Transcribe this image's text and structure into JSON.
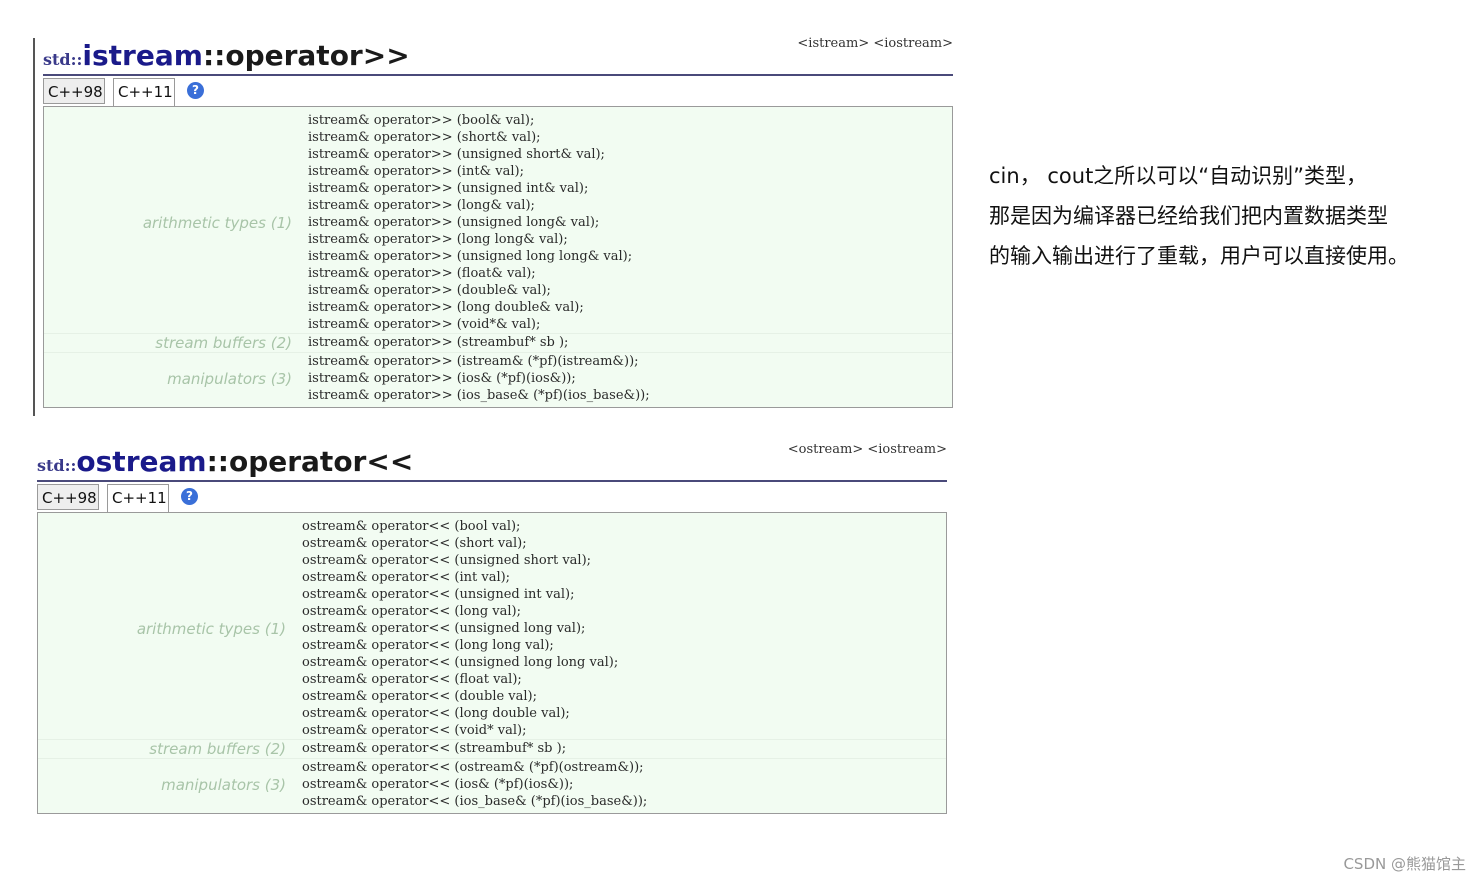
{
  "istream": {
    "title_ns": "std::",
    "title_class": "istream",
    "title_op": "::operator>>",
    "headers": "<istream> <iostream>",
    "tabs": [
      "C++98",
      "C++11"
    ],
    "help": "?",
    "groups": [
      {
        "label": "arithmetic types (1)",
        "lines": [
          "istream& operator>> (bool& val);",
          "istream& operator>> (short& val);",
          "istream& operator>> (unsigned short& val);",
          "istream& operator>> (int& val);",
          "istream& operator>> (unsigned int& val);",
          "istream& operator>> (long& val);",
          "istream& operator>> (unsigned long& val);",
          "istream& operator>> (long long& val);",
          "istream& operator>> (unsigned long long& val);",
          "istream& operator>> (float& val);",
          "istream& operator>> (double& val);",
          "istream& operator>> (long double& val);",
          "istream& operator>> (void*& val);"
        ]
      },
      {
        "label": "stream buffers (2)",
        "lines": [
          "istream& operator>> (streambuf* sb );"
        ]
      },
      {
        "label": "manipulators (3)",
        "lines": [
          "istream& operator>> (istream& (*pf)(istream&));",
          "istream& operator>> (ios& (*pf)(ios&));",
          "istream& operator>> (ios_base& (*pf)(ios_base&));"
        ]
      }
    ]
  },
  "ostream": {
    "title_ns": "std::",
    "title_class": "ostream",
    "title_op": "::operator<<",
    "headers": "<ostream> <iostream>",
    "tabs": [
      "C++98",
      "C++11"
    ],
    "help": "?",
    "groups": [
      {
        "label": "arithmetic types (1)",
        "lines": [
          "ostream& operator<< (bool val);",
          "ostream& operator<< (short val);",
          "ostream& operator<< (unsigned short val);",
          "ostream& operator<< (int val);",
          "ostream& operator<< (unsigned int val);",
          "ostream& operator<< (long val);",
          "ostream& operator<< (unsigned long val);",
          "ostream& operator<< (long long val);",
          "ostream& operator<< (unsigned long long val);",
          "ostream& operator<< (float val);",
          "ostream& operator<< (double val);",
          "ostream& operator<< (long double val);",
          "ostream& operator<< (void* val);"
        ]
      },
      {
        "label": "stream buffers (2)",
        "lines": [
          "ostream& operator<< (streambuf* sb );"
        ]
      },
      {
        "label": "manipulators (3)",
        "lines": [
          "ostream& operator<< (ostream& (*pf)(ostream&));",
          "ostream& operator<< (ios& (*pf)(ios&));",
          "ostream& operator<< (ios_base& (*pf)(ios_base&));"
        ]
      }
    ]
  },
  "note": [
    "cin， cout之所以可以“自动识别”类型，",
    "那是因为编译器已经给我们把内置数据类型",
    "的输入输出进行了重载，用户可以直接使用。"
  ],
  "watermark": "CSDN @熊猫馆主"
}
